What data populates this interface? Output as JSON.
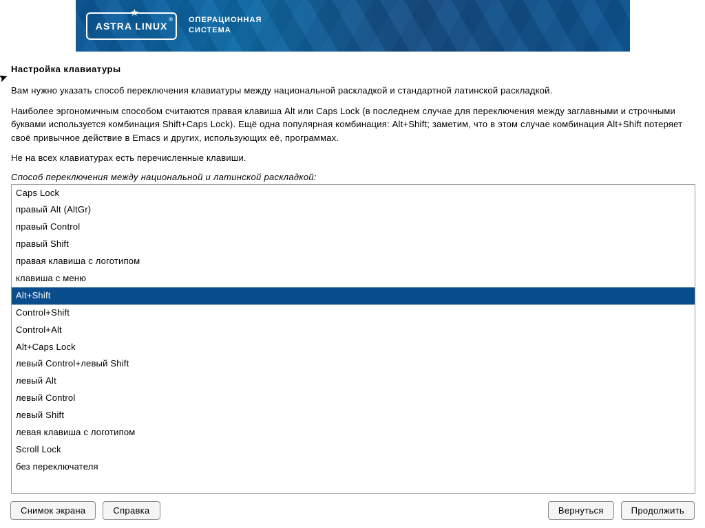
{
  "header": {
    "logo_text": "ASTRA LINUX",
    "subtitle_line1": "ОПЕРАЦИОННАЯ",
    "subtitle_line2": "СИСТЕМА"
  },
  "page": {
    "title": "Настройка клавиатуры",
    "para1": "Вам нужно указать способ переключения клавиатуры между национальной раскладкой и стандартной латинской раскладкой.",
    "para2": "Наиболее эргономичным способом считаются правая клавиша Alt или Caps Lock (в последнем случае для переключения между заглавными и строчными буквами используется комбинация Shift+Caps Lock). Ещё одна популярная комбинация: Alt+Shift; заметим, что в этом случае комбинация Alt+Shift потеряет своё привычное действие в Emacs и других, использующих её, программах.",
    "para3": "Не на всех клавиатурах есть перечисленные клавиши.",
    "list_label": "Способ переключения между национальной и латинской раскладкой:"
  },
  "options": [
    "Caps Lock",
    "правый Alt (AltGr)",
    "правый Control",
    "правый Shift",
    "правая клавиша с логотипом",
    "клавиша с меню",
    "Alt+Shift",
    "Control+Shift",
    "Control+Alt",
    "Alt+Caps Lock",
    "левый Control+левый Shift",
    "левый Alt",
    "левый Control",
    "левый Shift",
    "левая клавиша с логотипом",
    "Scroll Lock",
    "без переключателя"
  ],
  "selected_index": 6,
  "buttons": {
    "screenshot": "Снимок экрана",
    "help": "Справка",
    "back": "Вернуться",
    "continue": "Продолжить"
  }
}
